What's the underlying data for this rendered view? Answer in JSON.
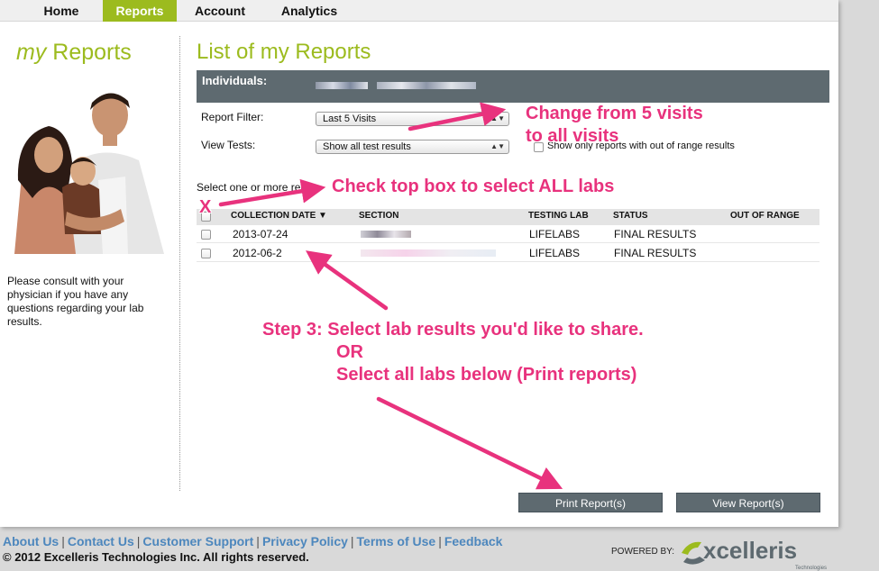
{
  "nav": {
    "items": [
      {
        "label": "Home"
      },
      {
        "label": "Reports"
      },
      {
        "label": "Account"
      },
      {
        "label": "Analytics"
      }
    ]
  },
  "sidebar": {
    "title_em": "my",
    "title_rest": " Reports",
    "note": "Please consult with your physician if you have any questions regarding your lab results."
  },
  "main": {
    "title": "List of my Reports",
    "individuals_label": "Individuals:",
    "report_filter_label": "Report Filter:",
    "report_filter_value": "Last 5 Visits",
    "view_tests_label": "View Tests:",
    "view_tests_value": "Show all test results",
    "show_only_text": "Show only reports with out of range results",
    "select_instruction": "Select one or more repo"
  },
  "table": {
    "headers": {
      "collection_date": "COLLECTION DATE",
      "section": "SECTION",
      "testing_lab": "TESTING LAB",
      "status": "STATUS",
      "out_of_range": "OUT OF RANGE"
    },
    "rows": [
      {
        "date": "2013-07-24",
        "lab": "LIFELABS",
        "status": "FINAL RESULTS"
      },
      {
        "date": "2012-06-2",
        "lab": "LIFELABS",
        "status": "FINAL RESULTS"
      }
    ]
  },
  "buttons": {
    "print": "Print Report(s)",
    "view": "View Report(s)"
  },
  "footer": {
    "links": [
      "About Us",
      "Contact Us",
      "Customer Support",
      "Privacy Policy",
      "Terms of Use",
      "Feedback"
    ],
    "copyright": "© 2012 Excelleris Technologies Inc. All rights reserved.",
    "powered_by": "POWERED BY:",
    "logo_text": "xcelleris",
    "logo_sub": "Technologies"
  },
  "annotations": {
    "change_line1": "Change from 5 visits",
    "change_line2": "to all visits",
    "check_top": "Check top box to select ALL labs",
    "x_mark": "X",
    "step3_line1": "Step 3: Select lab results you'd like to share.",
    "step3_line2": "OR",
    "step3_line3": "Select all labs below (Print reports)"
  },
  "colors": {
    "accent_green": "#9cbb1e",
    "bar_gray": "#5e6a70",
    "annotation_pink": "#e8327d",
    "link_blue": "#4d87bd"
  }
}
